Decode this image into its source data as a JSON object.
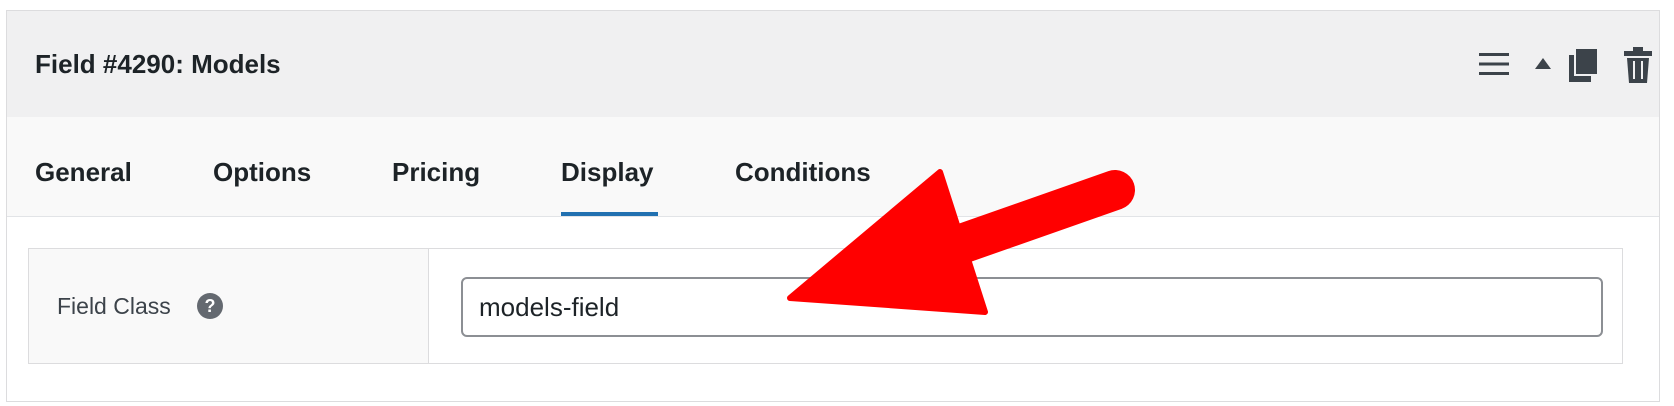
{
  "panel": {
    "title": "Field #4290: Models",
    "actions": {
      "menu_icon": "hamburger-menu-icon",
      "collapse_icon": "triangle-up-icon",
      "duplicate_icon": "copy-icon",
      "delete_icon": "trash-icon"
    }
  },
  "tabs": [
    {
      "label": "General"
    },
    {
      "label": "Options"
    },
    {
      "label": "Pricing"
    },
    {
      "label": "Display",
      "active": true
    },
    {
      "label": "Conditions"
    }
  ],
  "field_class": {
    "label": "Field Class",
    "help_icon": "question-circle-icon",
    "value": "models-field"
  },
  "colors": {
    "active_tab_underline": "#2271b1",
    "annotation_arrow": "#ff0000",
    "header_background": "#f0f0f1"
  }
}
